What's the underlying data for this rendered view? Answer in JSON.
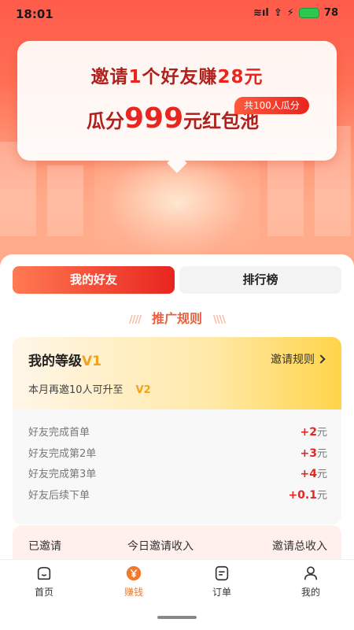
{
  "status": {
    "time": "18:01",
    "signal": "≋ıl",
    "network": "⇪",
    "battery": "78"
  },
  "promo": {
    "line1_a": "邀请",
    "line1_b": "1",
    "line1_c": "个好友赚",
    "line1_d": "28元",
    "line2_a": "瓜分",
    "line2_b": "999",
    "line2_c": "元红包池",
    "badge": "共100人瓜分"
  },
  "tabs": {
    "friends": "我的好友",
    "ranking": "排行榜"
  },
  "rules_title": "推广规则",
  "level": {
    "label": "我的等级",
    "value": "V1",
    "rules_link": "邀请规则",
    "upgrade_text": "本月再邀10人可升至",
    "next_level": "V2"
  },
  "rewards": [
    {
      "label": "好友完成首单",
      "amount": "+2",
      "unit": "元"
    },
    {
      "label": "好友完成第2单",
      "amount": "+3",
      "unit": "元"
    },
    {
      "label": "好友完成第3单",
      "amount": "+4",
      "unit": "元"
    },
    {
      "label": "好友后续下单",
      "amount": "+0.1",
      "unit": "元"
    }
  ],
  "stats": {
    "invited": "已邀请",
    "today_income": "今日邀请收入",
    "total_income": "邀请总收入"
  },
  "nav": [
    {
      "label": "首页",
      "icon": "home-icon"
    },
    {
      "label": "赚钱",
      "icon": "yen-icon"
    },
    {
      "label": "订单",
      "icon": "order-icon"
    },
    {
      "label": "我的",
      "icon": "profile-icon"
    }
  ],
  "colors": {
    "accent": "#e8251f",
    "gold": "#f0a21a",
    "nav_active": "#f07a2a"
  }
}
